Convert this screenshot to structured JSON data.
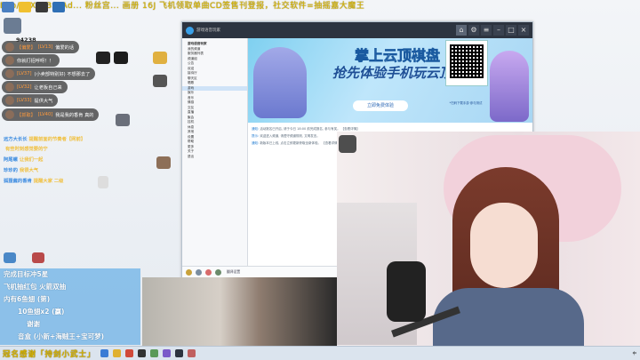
{
  "marquee": "Ebb/SFX/OBS_Ad... 粉丝宫...  画册 16J 飞机领取单曲CD签售刊登报，社交软件=抽摇嘉大魔王",
  "chat": {
    "viewer_count": "94238",
    "bubbles": [
      {
        "lv": "[LV13]",
        "name": "[偏爱]",
        "text": "偏爱的话",
        "prefix": "【偏爱】"
      },
      {
        "lv": "",
        "name": "",
        "text": "你就打招呼呀！！",
        "prefix": ""
      },
      {
        "lv": "[LV37]",
        "name": "",
        "text": "(小卖部特别好) 不想那去了",
        "prefix": ""
      },
      {
        "lv": "[LV32]",
        "name": "",
        "text": "让老板自己来",
        "prefix": ""
      },
      {
        "lv": "[LV33]",
        "name": "",
        "text": "提供大气",
        "prefix": ""
      },
      {
        "lv": "[LV40]",
        "name": "",
        "text": "我是我的香肯  真的",
        "prefix": "【抓取】"
      }
    ],
    "plain": [
      {
        "name": "远方大长长",
        "text": "提醒前面的节奏者【网前】"
      },
      {
        "name": "",
        "text": "有些时刻感觉要的宁"
      },
      {
        "name": "阿尾螺",
        "text": "让我们一起"
      },
      {
        "name": "珍珍的",
        "text": "我很大气"
      },
      {
        "name": "狐狸酱的香肯",
        "text": "提醒大家 二级"
      }
    ]
  },
  "client": {
    "title": "游戏语音玩家",
    "ad_title": "掌上云顶棋盘",
    "ad_sub": "抢先体验手机玩云顶",
    "ad_button": "立即免费体验",
    "qr_caption": "*扫码下载手游·参与测试",
    "left_rows": [
      "游戏语音玩家",
      "我的频道",
      "服务器列表",
      "频道组",
      "公告",
      "欢迎",
      "接待厅",
      "聊天区",
      "唱歌",
      "游戏",
      "娱乐",
      "音乐",
      "情感",
      "交友",
      "直播",
      "聚会",
      "挂机",
      "休息",
      "其他",
      "设置",
      "帮助",
      "更多",
      "关于",
      "退出"
    ],
    "system_lines": [
      {
        "k": "通知:",
        "t": "活动报名已开启, 请于今日 18:00 前完成报名, 参与有奖。 【查看详情】"
      },
      {
        "k": "提示:",
        "t": "欢迎进入频道, 请遵守频道规则, 文明发言。"
      },
      {
        "k": "通知:",
        "t": "新版本已上线, 点击立即更新获取全新体验。 【查看详情】"
      }
    ],
    "toolbar_label": "翻译设置"
  },
  "info": {
    "lines": [
      "完成目标冲5星",
      "飞机抽红包 火箭双抽",
      "内有6鱼翅 (第)",
      "10鱼翅x2 (赢)",
      "谢谢",
      "音盒 (小新+海贼王+宝可梦)"
    ]
  },
  "taskbar": {
    "label": "冠名感谢「持剑小武士」",
    "right": "中"
  },
  "colors": {
    "marquee": "#d9b800",
    "info_bg": "#7bb8e8",
    "titlebar": "#2d3440"
  }
}
